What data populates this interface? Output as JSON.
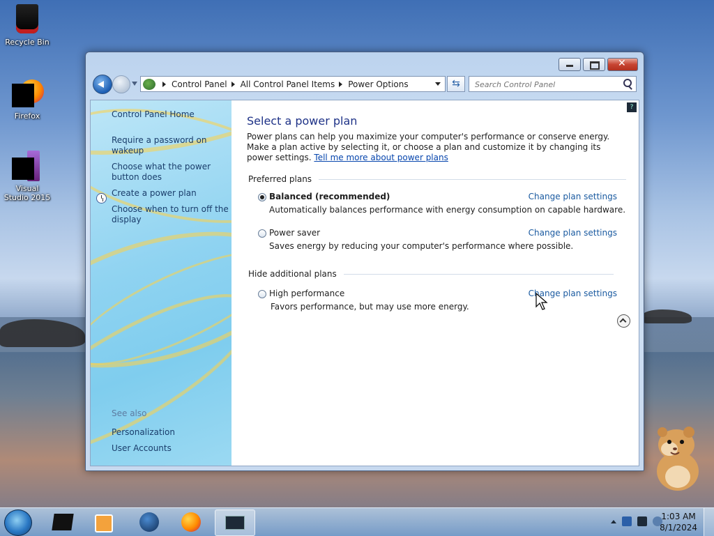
{
  "desktop": {
    "icons": [
      {
        "label": "Recycle Bin"
      },
      {
        "label": "Firefox"
      },
      {
        "label": "Visual Studio 2015"
      }
    ]
  },
  "window": {
    "breadcrumbs": [
      "Control Panel",
      "All Control Panel Items",
      "Power Options"
    ],
    "search_placeholder": "Search Control Panel",
    "sidebar": {
      "home": "Control Panel Home",
      "links": [
        "Require a password on wakeup",
        "Choose what the power button does",
        "Create a power plan",
        "Choose when to turn off the display"
      ],
      "see_also": "See also",
      "see_also_links": [
        "Personalization",
        "User Accounts"
      ]
    },
    "main": {
      "title": "Select a power plan",
      "description": "Power plans can help you maximize your computer's performance or conserve energy. Make a plan active by selecting it, or choose a plan and customize it by changing its power settings.",
      "learn_link": "Tell me more about power plans",
      "preferred_header": "Preferred plans",
      "plans": [
        {
          "name": "Balanced (recommended)",
          "desc": "Automatically balances performance with energy consumption on capable hardware.",
          "selected": true,
          "link": "Change plan settings"
        },
        {
          "name": "Power saver",
          "desc": "Saves energy by reducing your computer's performance where possible.",
          "selected": false,
          "link": "Change plan settings"
        }
      ],
      "hide_header": "Hide additional plans",
      "additional_plans": [
        {
          "name": "High performance",
          "desc": "Favors performance, but may use more energy.",
          "selected": false,
          "link": "Change plan settings"
        }
      ]
    }
  },
  "taskbar": {
    "time": "1:03 AM",
    "date": "8/1/2024"
  },
  "colors": {
    "link": "#1a5aa0",
    "title": "#1e3287"
  }
}
